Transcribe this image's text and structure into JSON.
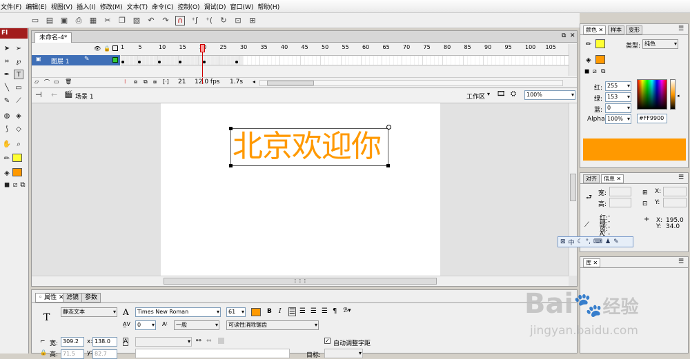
{
  "menu": [
    "文件(F)",
    "编辑(E)",
    "视图(V)",
    "插入(I)",
    "修改(M)",
    "文本(T)",
    "命令(C)",
    "控制(O)",
    "调试(D)",
    "窗口(W)",
    "帮助(H)"
  ],
  "app_logo": "Fl",
  "document": {
    "tab_title": "未命名-4*",
    "layer_name": "图层 1",
    "frame_numbers": [
      "1",
      "5",
      "10",
      "15",
      "20",
      "25",
      "30",
      "35",
      "40",
      "45",
      "50",
      "55",
      "60",
      "65",
      "70",
      "75",
      "80",
      "85",
      "90",
      "95",
      "100",
      "105"
    ],
    "current_frame": "21",
    "fps": "12.0 fps",
    "elapsed": "1.7s",
    "scene_name": "场景 1",
    "workspace_label": "工作区",
    "zoom": "100%",
    "stage_text": "北京欢迎你",
    "text_color": "#FF9900"
  },
  "properties": {
    "tabs": [
      "属性",
      "滤镜",
      "参数"
    ],
    "text_type": "静态文本",
    "font_family": "Times New Roman",
    "font_size": "61",
    "letter_spacing": "0",
    "char_position": "一般",
    "anti_alias": "可读性消除锯齿",
    "width_label": "宽:",
    "width_value": "309.2",
    "x_label": "x:",
    "x_value": "138.0",
    "height_label": "高:",
    "height_value": "71.5",
    "y_label": "y:",
    "y_value": "82.7",
    "auto_kern_label": "自动调整字距",
    "target_label": "目标:",
    "bold_label": "B",
    "italic_label": "I"
  },
  "color_panel": {
    "tabs": [
      "颜色",
      "样本",
      "变形"
    ],
    "type_label": "类型:",
    "type_value": "纯色",
    "red_label": "红:",
    "red_value": "255",
    "green_label": "绿:",
    "green_value": "153",
    "blue_label": "蓝:",
    "blue_value": "0",
    "alpha_label": "Alpha:",
    "alpha_value": "100%",
    "hex_value": "#FF9900",
    "fill_color": "#FF9900",
    "stroke_color": "#FFFF33"
  },
  "info_panel": {
    "tabs": [
      "对齐",
      "信息"
    ],
    "width_label": "宽:",
    "height_label": "高:",
    "x_label": "X:",
    "y_label": "Y:",
    "red_label": "红:",
    "red_value": "-",
    "green_label": "绿:",
    "green_value": "-",
    "blue_label": "蓝:",
    "blue_value": "-",
    "alpha_label": "A:",
    "alpha_value": "-",
    "cursor_x_label": "X:",
    "cursor_x": "195.0",
    "cursor_y_label": "Y:",
    "cursor_y": "34.0"
  },
  "ime_bar": {
    "mode": "中"
  },
  "library_panel": {
    "tab": "库"
  },
  "watermark": {
    "brand": "Bai",
    "brand_cn": "经验",
    "url": "jingyan.baidu.com"
  }
}
